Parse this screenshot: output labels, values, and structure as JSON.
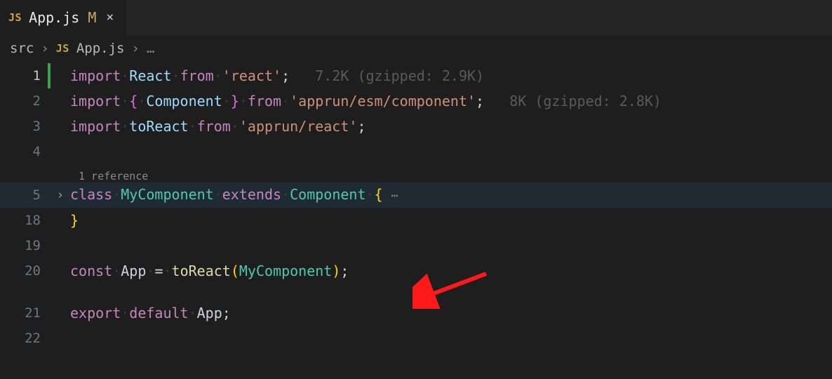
{
  "tab": {
    "icon_label": "JS",
    "title": "App.js",
    "modified_indicator": "M",
    "close_icon": "×"
  },
  "breadcrumbs": {
    "root": "src",
    "sep": "›",
    "file_icon": "JS",
    "file": "App.js",
    "tail": "…"
  },
  "codelens": {
    "text": "1 reference"
  },
  "import_cost": {
    "line1": "7.2K (gzipped: 2.9K)",
    "line2": "8K (gzipped: 2.8K)"
  },
  "lines": {
    "n1": "1",
    "n2": "2",
    "n3": "3",
    "n4": "4",
    "n5": "5",
    "n18": "18",
    "n19": "19",
    "n20": "20",
    "n21": "21",
    "n22": "22"
  },
  "tokens": {
    "import": "import",
    "from": "from",
    "class": "class",
    "extends": "extends",
    "const": "const",
    "export": "export",
    "default": "default",
    "React": "React",
    "Component": "Component",
    "toReact": "toReact",
    "MyComponent": "MyComponent",
    "App": "App",
    "str_react": "'react'",
    "str_apprun_comp": "'apprun/esm/component'",
    "str_apprun_react": "'apprun/react'",
    "lbrace": "{",
    "rbrace": "}",
    "lparen": "(",
    "rparen": ")",
    "semi": ";",
    "eq": "=",
    "dots": "⋯",
    "chev": "›"
  },
  "whitespace_dot": "·"
}
